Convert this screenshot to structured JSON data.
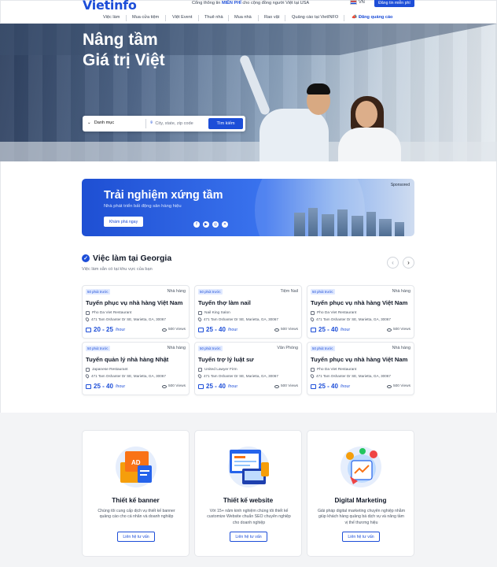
{
  "brand": {
    "logo": "Vietinfo"
  },
  "topbar": {
    "tagline_prefix": "Cổng thông tin ",
    "tagline_bold": "MIỄN PHÍ",
    "tagline_suffix": " cho cộng đồng người Việt tại USA",
    "language": "VN",
    "post_button": "Đăng tin miễn phí"
  },
  "nav": {
    "items": [
      "Việc làm",
      "Mua cửa tiệm",
      "Việt Event",
      "Thuê nhà",
      "Mua nhà",
      "Rao vặt",
      "Quảng cáo tại VietINFO"
    ],
    "ad_label": "Đăng quảng cáo"
  },
  "hero": {
    "title_line1": "Nâng tầm",
    "title_line2": "Giá trị Việt",
    "category_label": "Danh mục",
    "location_placeholder": "City, state, zip code",
    "search_button": "Tìm kiếm"
  },
  "banner": {
    "title": "Trải nghiệm xứng tầm",
    "subtitle": "Nhà phát triển bất động sản hàng hiệu",
    "button": "Khám phá ngay",
    "sponsored": "Sponsored"
  },
  "jobs": {
    "title": "Việc làm tại Georgia",
    "subtitle": "Việc làm sẵn có tại khu vực của bạn",
    "items": [
      {
        "badge": "50 phút trước",
        "type": "Nhà hàng",
        "title": "Tuyển phục vụ nhà hàng Việt Nam",
        "company": "Pho Da Viet Restaurant",
        "address": "471 Tam Oshanter Dr SE, Marietta, GA, 30067",
        "salary": "20 - 25",
        "unit": "/hour",
        "views": "500 Views"
      },
      {
        "badge": "50 phút trước",
        "type": "Tiệm Nail",
        "title": "Tuyển thợ làm nail",
        "company": "Nail King Salon",
        "address": "471 Tam Oshanter Dr SE, Marietta, GA, 30067",
        "salary": "25 - 40",
        "unit": "/hour",
        "views": "500 Views"
      },
      {
        "badge": "50 phút trước",
        "type": "Nhà hàng",
        "title": "Tuyển phục vụ nhà hàng Việt Nam",
        "company": "Pho Da Viet Restaurant",
        "address": "471 Tam Oshanter Dr SE, Marietta, GA, 30067",
        "salary": "25 - 40",
        "unit": "/hour",
        "views": "500 Views"
      },
      {
        "badge": "50 phút trước",
        "type": "Nhà hàng",
        "title": "Tuyển quản lý nhà hàng Nhật",
        "company": "Japanese Restaurant",
        "address": "471 Tam Oshanter Dr SE, Marietta, GA, 30067",
        "salary": "25 - 40",
        "unit": "/hour",
        "views": "500 Views"
      },
      {
        "badge": "50 phút trước",
        "type": "Văn Phòng",
        "title": "Tuyển trợ lý luật sư",
        "company": "United Lawyer Firm",
        "address": "471 Tam Oshanter Dr SE, Marietta, GA, 30067",
        "salary": "25 - 40",
        "unit": "/hour",
        "views": "500 Views"
      },
      {
        "badge": "50 phút trước",
        "type": "Nhà hàng",
        "title": "Tuyển phục vụ nhà hàng Việt Nam",
        "company": "Pho Da Viet Restaurant",
        "address": "471 Tam Oshanter Dr SE, Marietta, GA, 30067",
        "salary": "25 - 40",
        "unit": "/hour",
        "views": "500 Views"
      }
    ]
  },
  "services": [
    {
      "icon": "banner-design-icon",
      "title": "Thiết kế banner",
      "desc": "Chúng tôi cung cấp dịch vụ thiết kế banner quảng cáo cho cá nhân và doanh nghiệp",
      "button": "Liên hệ tư vấn"
    },
    {
      "icon": "website-design-icon",
      "title": "Thiết kế website",
      "desc": "Với 15+ năm kinh nghiệm chúng tôi thiết kế customize Website chuẩn SEO chuyên nghiệp cho doanh nghiệp",
      "button": "Liên hệ tư vấn"
    },
    {
      "icon": "digital-marketing-icon",
      "title": "Digital Marketing",
      "desc": "Giải pháp digital marketing chuyên nghiệp nhằm giúp khách hàng quảng bá dịch vụ và nâng tầm vị thế thương hiệu",
      "button": "Liên hệ tư vấn"
    }
  ],
  "colors": {
    "brand": "#1d4ed8",
    "text": "#111827",
    "muted": "#6b7280"
  }
}
